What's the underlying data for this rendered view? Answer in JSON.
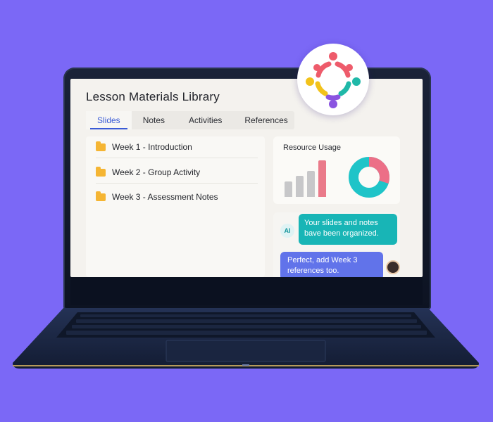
{
  "app": {
    "title": "Lesson Materials Library"
  },
  "tabs": [
    {
      "label": "Slides",
      "active": true
    },
    {
      "label": "Notes",
      "active": false
    },
    {
      "label": "Activities",
      "active": false
    },
    {
      "label": "References",
      "active": false
    }
  ],
  "files": [
    {
      "name": "Week 1 - Introduction",
      "icon": "folder-icon"
    },
    {
      "name": "Week 2 - Group Activity",
      "icon": "folder-icon"
    },
    {
      "name": "Week 3 - Assessment Notes",
      "icon": "folder-icon"
    }
  ],
  "usage": {
    "title": "Resource Usage",
    "bar_values": [
      0.42,
      0.58,
      0.72,
      1.0
    ],
    "bar_colors": [
      "#c7c7c9",
      "#c7c7c9",
      "#c7c7c9",
      "#ea7a8a"
    ],
    "donut_fraction": 0.3,
    "donut_colors": {
      "primary": "#1fc4c8",
      "secondary": "#ec6f87"
    }
  },
  "chat": {
    "ai_avatar": "AI",
    "ai_message": "Your slides and notes bave been organized.",
    "user_message": "Perfect, add Week 3 references too."
  },
  "colors": {
    "background": "#7b68f6",
    "accent": "#3a5bd6",
    "folder": "#f5b533",
    "ai_bubble": "#18b5b6",
    "user_bubble": "#6173ea"
  }
}
